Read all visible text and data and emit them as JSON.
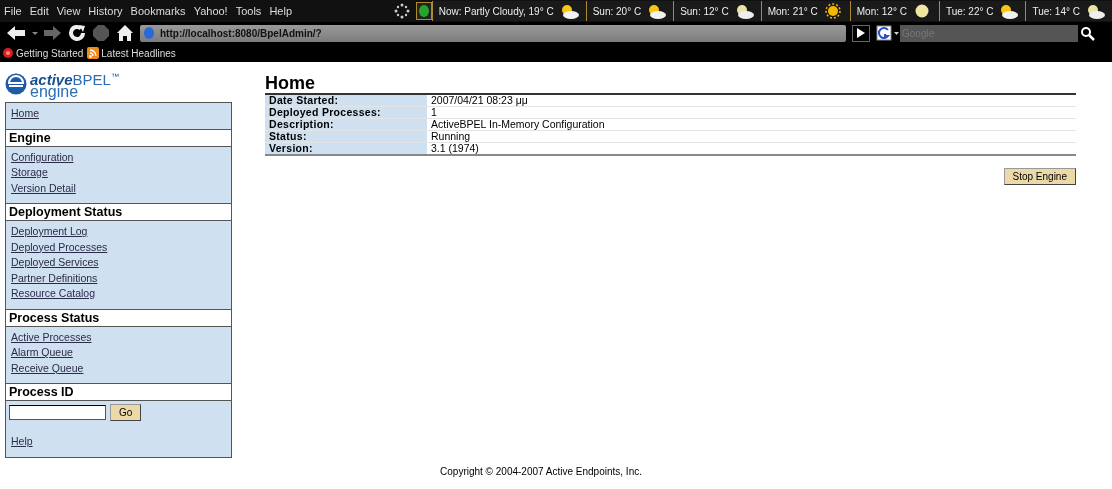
{
  "browser": {
    "menu": [
      "File",
      "Edit",
      "View",
      "History",
      "Bookmarks",
      "Yahoo!",
      "Tools",
      "Help"
    ],
    "weather": [
      {
        "label": "Now: Partly Cloudy, 19° C",
        "kind": "sun-cloud"
      },
      {
        "label": "Sun: 20° C",
        "kind": "sun-cloud"
      },
      {
        "label": "Sun: 12° C",
        "kind": "moon-cloud"
      },
      {
        "label": "Mon: 21° C",
        "kind": "sun"
      },
      {
        "label": "Mon: 12° C",
        "kind": "moon"
      },
      {
        "label": "Tue: 22° C",
        "kind": "sun-cloud"
      },
      {
        "label": "Tue: 14° C",
        "kind": "moon-cloud"
      }
    ],
    "address": "http://localhost:8080/BpelAdmin/?",
    "search": {
      "placeholder": "Google"
    },
    "bookmarks": [
      {
        "label": "Getting Started",
        "kind": "star"
      },
      {
        "label": "Latest Headlines",
        "kind": "feed"
      }
    ]
  },
  "logo": {
    "brand": "active",
    "product": "BPEL",
    "tm": "™",
    "sub": "engine"
  },
  "sidebar": [
    {
      "kind": "links",
      "items": [
        "Home"
      ]
    },
    {
      "kind": "links",
      "title": "Engine",
      "items": [
        "Configuration",
        "Storage",
        "Version Detail"
      ]
    },
    {
      "kind": "links",
      "title": "Deployment Status",
      "items": [
        "Deployment Log",
        "Deployed Processes",
        "Deployed Services",
        "Partner Definitions",
        "Resource Catalog"
      ]
    },
    {
      "kind": "links",
      "title": "Process Status",
      "items": [
        "Active Processes",
        "Alarm Queue",
        "Receive Queue"
      ]
    },
    {
      "kind": "form",
      "title": "Process ID",
      "button": "Go"
    },
    {
      "kind": "links",
      "items": [
        "Help"
      ]
    }
  ],
  "main": {
    "title": "Home",
    "rows": [
      {
        "label": "Date Started:",
        "value": "2007/04/21 08:23 μμ"
      },
      {
        "label": "Deployed Processes:",
        "value": "1"
      },
      {
        "label": "Description:",
        "value": "ActiveBPEL In-Memory Configuration"
      },
      {
        "label": "Status:",
        "value": "Running"
      },
      {
        "label": "Version:",
        "value": "3.1 (1974)"
      }
    ],
    "button": "Stop Engine"
  },
  "footer": "Copyright © 2004-2007 Active Endpoints, Inc."
}
